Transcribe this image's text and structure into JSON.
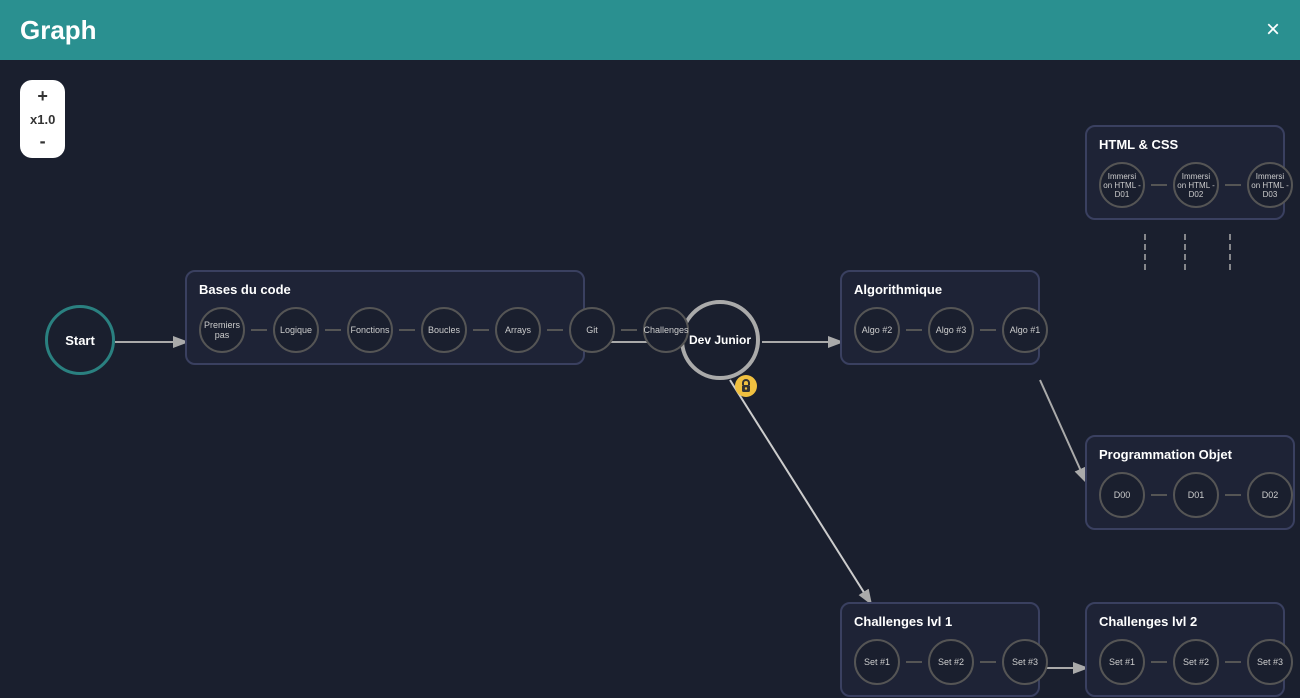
{
  "header": {
    "title": "Graph",
    "close_label": "×"
  },
  "zoom": {
    "plus_label": "+",
    "level_label": "x1.0",
    "minus_label": "-"
  },
  "nodes": {
    "start": "Start",
    "dev_junior": "Dev Junior"
  },
  "modules": {
    "bases": {
      "title": "Bases du code",
      "items": [
        "Premiers pas",
        "Logique",
        "Fonctions",
        "Boucles",
        "Arrays",
        "Git",
        "Challenges"
      ]
    },
    "algo": {
      "title": "Algorithmique",
      "items": [
        "Algo #2",
        "Algo #3",
        "Algo #1"
      ]
    },
    "html": {
      "title": "HTML & CSS",
      "items": [
        "Immersi on HTML - D01",
        "Immersi on HTML - D02",
        "Immersi on HTML - D03"
      ]
    },
    "prog": {
      "title": "Programmation Objet",
      "items": [
        "D00",
        "D01",
        "D02"
      ]
    },
    "chal1": {
      "title": "Challenges lvl 1",
      "items": [
        "Set #1",
        "Set #2",
        "Set #3"
      ]
    },
    "chal2": {
      "title": "Challenges lvl 2",
      "items": [
        "Set #1",
        "Set #2",
        "Set #3"
      ]
    }
  },
  "colors": {
    "header_bg": "#2a9090",
    "canvas_bg": "#1a1f2e",
    "module_border": "#3a4060",
    "module_bg": "#1e2336",
    "start_border": "#2a8080",
    "dev_junior_border": "#aaaaaa",
    "line_color": "#aaaaaa",
    "dashed_line": "#aaaaaa"
  }
}
